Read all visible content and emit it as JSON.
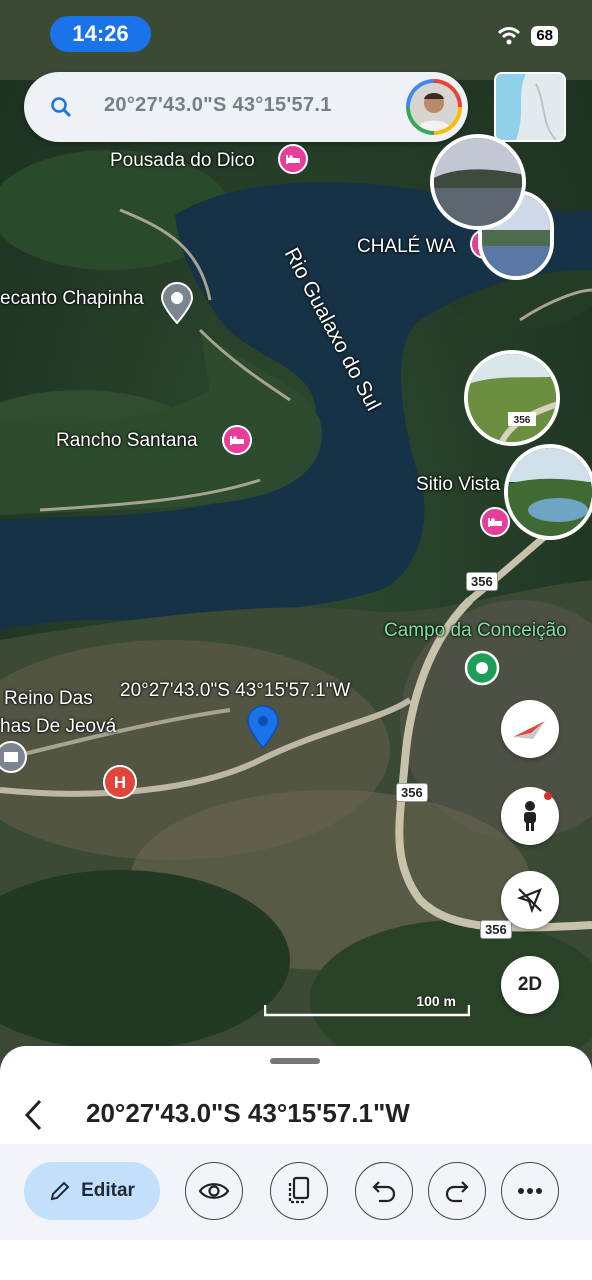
{
  "status": {
    "time": "14:26",
    "battery": "68"
  },
  "search": {
    "query": "20°27'43.0\"S 43°15'57.1"
  },
  "places": {
    "pousada": "Pousada do Dico",
    "chale": "CHALÉ WA",
    "recanto": "ecanto Chapinha",
    "rio": "Rio Gualaxo do Sul",
    "rancho": "Rancho Santana",
    "sitio": "Sitio Vista",
    "campo": "Campo da Conceição",
    "reino1": "Reino Das",
    "reino2": "has De Jeová",
    "marker_coords": "20°27'43.0\"S 43°15'57.1\"W"
  },
  "roads": {
    "r1": "356",
    "r2": "356",
    "r3": "356",
    "r4": "356"
  },
  "scale": {
    "label": "100 m"
  },
  "controls": {
    "mode": "2D"
  },
  "sheet": {
    "title": "20°27'43.0\"S 43°15'57.1\"W",
    "edit_label": "Editar"
  },
  "icons": [
    "search-icon",
    "hotel-icon",
    "place-pin-icon",
    "hospital-icon",
    "compass-icon",
    "street-view-icon",
    "location-arrow-icon",
    "back-icon",
    "pencil-icon",
    "eye-icon",
    "layers-icon",
    "undo-icon",
    "redo-icon",
    "more-icon"
  ]
}
